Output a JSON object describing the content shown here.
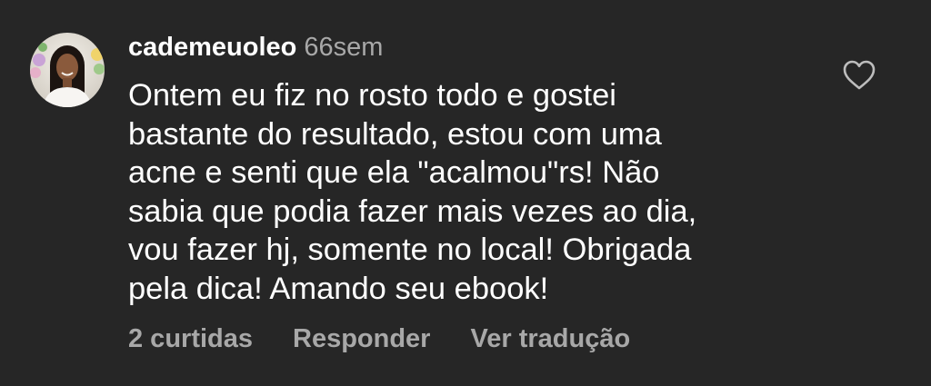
{
  "comment": {
    "username": "cademeuoleo",
    "timestamp": "66sem",
    "text_lines": [
      "Ontem eu fiz no rosto todo e gostei",
      "bastante do resultado, estou com uma",
      "acne e senti que ela \"acalmou\"rs! Não",
      "sabia que podia fazer mais vezes ao dia,",
      "vou fazer hj, somente no local! Obrigada",
      "pela dica! Amando seu ebook!"
    ],
    "actions": {
      "likes": "2 curtidas",
      "reply": "Responder",
      "translate": "Ver tradução"
    },
    "like_icon": "heart-outline-icon",
    "colors": {
      "background": "#262626",
      "text": "#ffffff",
      "secondary": "#a8a8a8"
    }
  }
}
